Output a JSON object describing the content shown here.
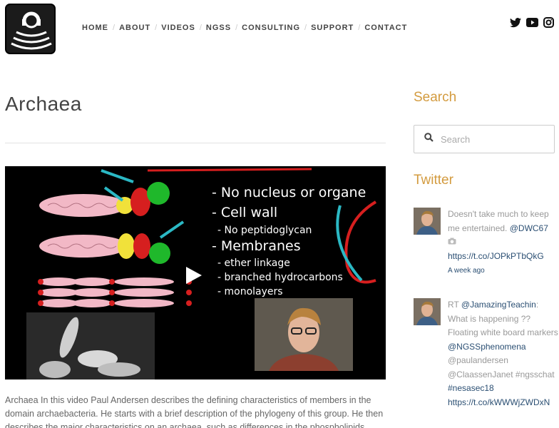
{
  "header": {
    "nav": [
      "HOME",
      "ABOUT",
      "VIDEOS",
      "NGSS",
      "CONSULTING",
      "SUPPORT",
      "CONTACT"
    ],
    "social": [
      "twitter-icon",
      "youtube-icon",
      "instagram-icon"
    ]
  },
  "main": {
    "title": "Archaea",
    "slide_lines": [
      "- No nucleus or organe",
      "- Cell wall",
      "- No peptidoglycan",
      "- Membranes",
      "- ether linkage",
      "- branched hydrocarbons",
      "- monolayers"
    ],
    "description": "Archaea In this video Paul Andersen describes the defining characteristics of members in the domain archaebacteria. He starts with a brief description of the phylogeny of this group. He then describes the major characteristics on an archaea, such as differences in the phospholipids"
  },
  "sidebar": {
    "search_title": "Search",
    "search_placeholder": "Search",
    "twitter_title": "Twitter",
    "tweets": [
      {
        "text1": "Doesn't take much to keep me entertained. ",
        "mention": "@DWC67",
        "link": "https://t.co/JOPkPTbQkG",
        "time": "A week ago"
      },
      {
        "prefix": "RT ",
        "mention": "@JamazingTeachin",
        "text": ": What is happening ?? Floating white board markers",
        "line3": "@NGSSphenomena",
        "line4": "@paulandersen",
        "line5": "@ClaassenJanet #ngsschat",
        "line6": "#nesasec18",
        "link": "https://t.co/kWWWjZWDxN"
      }
    ]
  },
  "colors": {
    "accent": "#d39b3f",
    "link": "#2b4f73"
  }
}
